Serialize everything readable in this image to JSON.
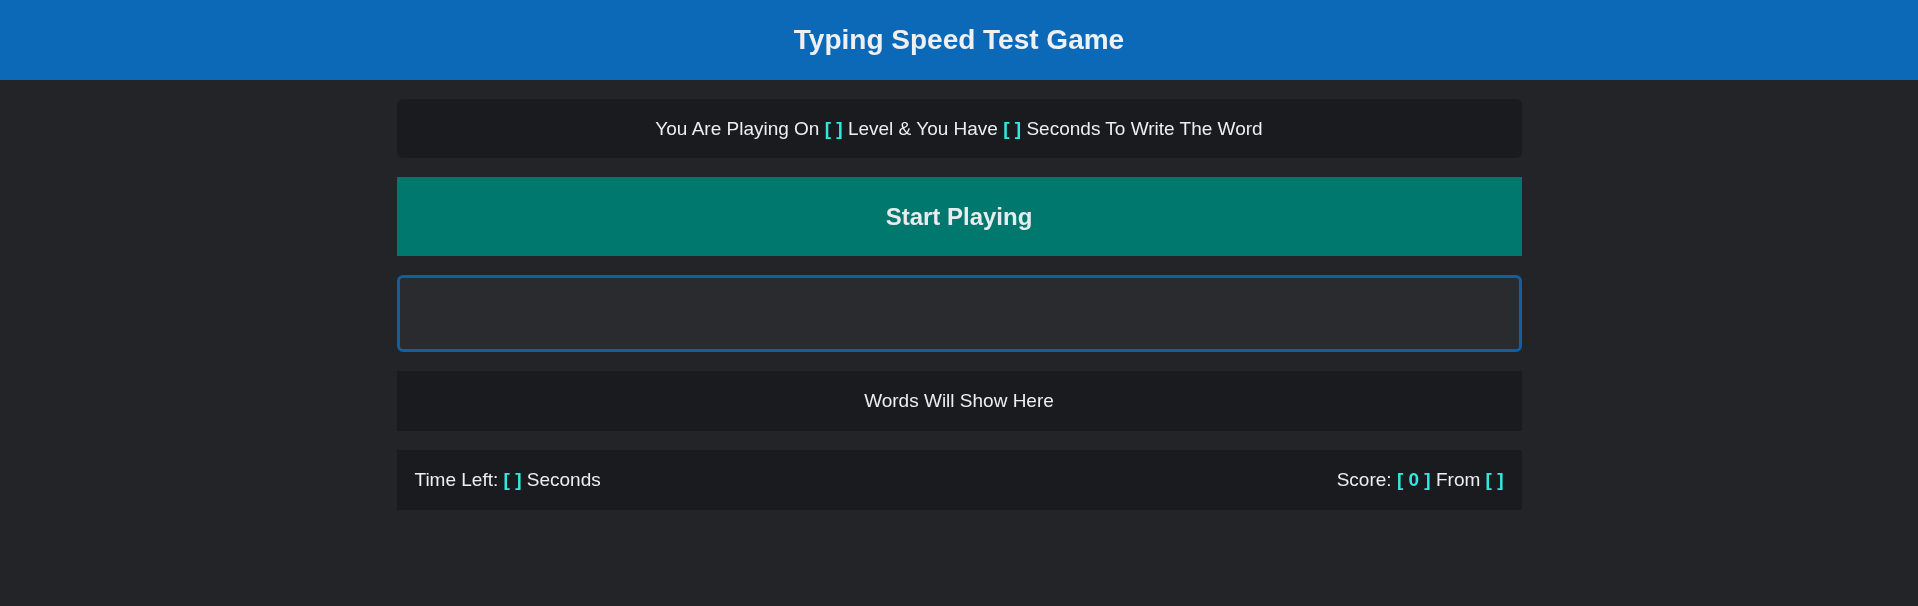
{
  "header": {
    "title": "Typing Speed Test Game"
  },
  "message": "You Are Playing On **[ ]** Level & You Have **[ ]** Seconds To Write The Word",
  "start_button": "Start Playing",
  "answer_field": {
    "focused": true
  },
  "words_area": "Words Will Show Here",
  "footer": {
    "time_left": "Time Left: **[ ]** Seconds",
    "score": "Score: **[ 0 ]** From **[ ]**"
  }
}
